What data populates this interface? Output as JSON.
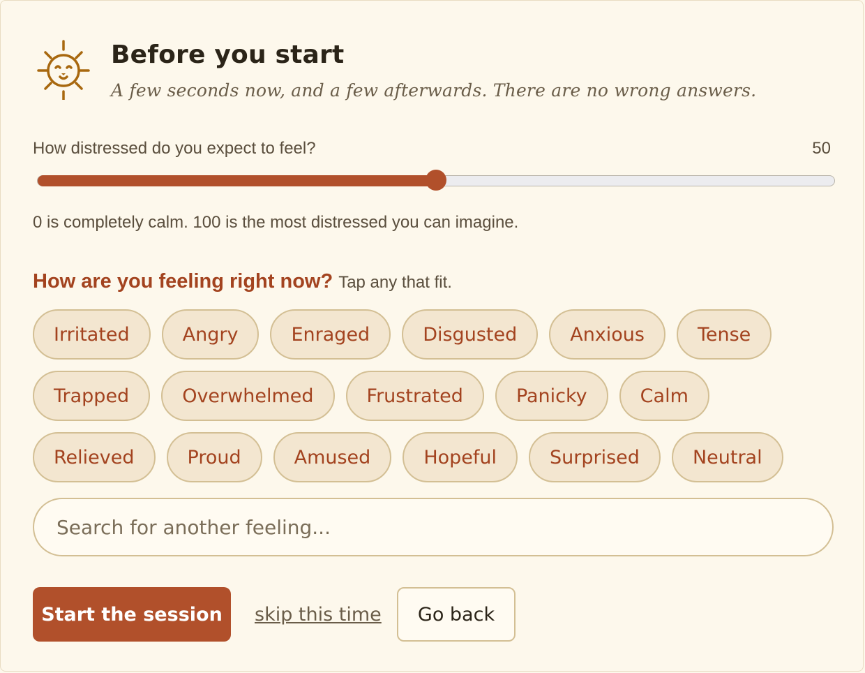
{
  "header": {
    "title": "Before you start",
    "subtitle": "A few seconds now, and a few afterwards. There are no wrong answers.",
    "logo_icon": "sun-face-icon"
  },
  "slider": {
    "label": "How distressed do you expect to feel?",
    "value": 50,
    "value_text": "50",
    "min": 0,
    "max": 100,
    "hint": "0 is completely calm. 100 is the most distressed you can imagine."
  },
  "feelings": {
    "question": "How are you feeling right now?",
    "instruction": "Tap any that fit.",
    "chips": [
      "Irritated",
      "Angry",
      "Enraged",
      "Disgusted",
      "Anxious",
      "Tense",
      "Trapped",
      "Overwhelmed",
      "Frustrated",
      "Panicky",
      "Calm",
      "Relieved",
      "Proud",
      "Amused",
      "Hopeful",
      "Surprised",
      "Neutral"
    ]
  },
  "search": {
    "placeholder": "Search for another feeling..."
  },
  "actions": {
    "start_label": "Start the session",
    "skip_label": "skip this time",
    "back_label": "Go back"
  },
  "colors": {
    "accent": "#b1502b",
    "background": "#fdf8ec",
    "chip_bg": "#f3e6d0",
    "chip_border": "#d3bf94",
    "icon": "#a8680f"
  }
}
